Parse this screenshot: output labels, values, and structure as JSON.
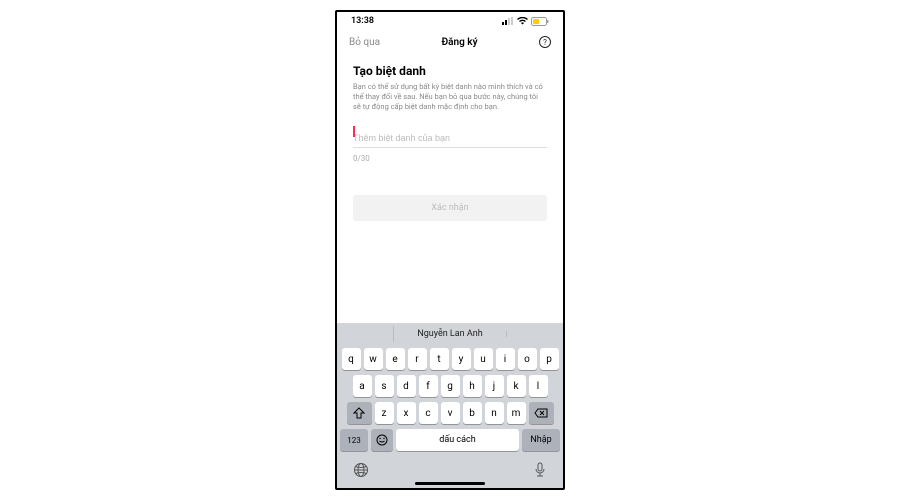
{
  "status": {
    "time": "13:38"
  },
  "nav": {
    "skip": "Bỏ qua",
    "title": "Đăng ký",
    "help_glyph": "?"
  },
  "page": {
    "title": "Tạo biệt danh",
    "description": "Bạn có thể sử dụng bất kỳ biệt danh nào mình thích và có thể thay đổi về sau. Nếu bạn bỏ qua bước này, chúng tôi sẽ tự động cấp biệt danh mặc định cho bạn.",
    "input_placeholder": "Thêm biệt danh của bạn",
    "counter": "0/30",
    "confirm": "Xác nhận"
  },
  "keyboard": {
    "suggestion_left": "",
    "suggestion_mid": "Nguyễn Lan Anh",
    "suggestion_right": "",
    "row1": [
      "q",
      "w",
      "e",
      "r",
      "t",
      "y",
      "u",
      "i",
      "o",
      "p"
    ],
    "row2": [
      "a",
      "s",
      "d",
      "f",
      "g",
      "h",
      "j",
      "k",
      "l"
    ],
    "row3": [
      "z",
      "x",
      "c",
      "v",
      "b",
      "n",
      "m"
    ],
    "numkey": "123",
    "space": "dấu cách",
    "enter": "Nhập"
  }
}
